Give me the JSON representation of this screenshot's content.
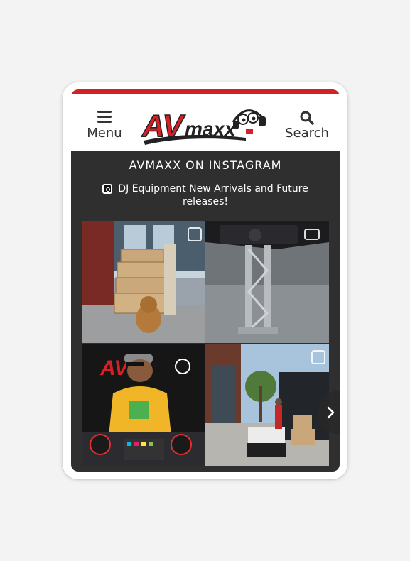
{
  "header": {
    "menu_label": "Menu",
    "search_label": "Search",
    "logo_text_av": "AV",
    "logo_text_maxx": "maxx"
  },
  "instagram": {
    "title": "AVMAXX ON INSTAGRAM",
    "caption": "DJ Equipment New Arrivals and Future releases!",
    "posts": [
      {
        "description_icon": "gallery-icon"
      },
      {
        "description_icon": "video-icon"
      },
      {
        "description_icon": "none"
      },
      {
        "description_icon": "gallery-icon"
      }
    ]
  },
  "colors": {
    "accent": "#d42027",
    "section_bg": "#2f2f2f",
    "text_light": "#ffffff",
    "text_dark": "#333333"
  }
}
